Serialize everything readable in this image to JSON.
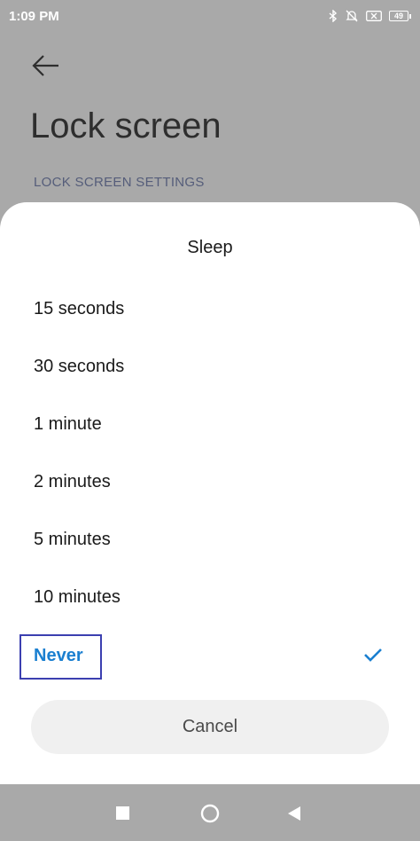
{
  "status_bar": {
    "time": "1:09 PM",
    "battery": "49",
    "icons": [
      "bluetooth-icon",
      "muted-bell-icon",
      "sim-x-icon",
      "battery-icon"
    ]
  },
  "page": {
    "title": "Lock screen",
    "section_header": "LOCK SCREEN SETTINGS",
    "back_icon": "back-arrow-icon"
  },
  "dialog": {
    "title": "Sleep",
    "options": [
      {
        "label": "15 seconds",
        "selected": false
      },
      {
        "label": "30 seconds",
        "selected": false
      },
      {
        "label": "1 minute",
        "selected": false
      },
      {
        "label": "2 minutes",
        "selected": false
      },
      {
        "label": "5 minutes",
        "selected": false
      },
      {
        "label": "10 minutes",
        "selected": false
      },
      {
        "label": "Never",
        "selected": true
      }
    ],
    "cancel_label": "Cancel",
    "accent_color": "#1a7fd0"
  },
  "nav_bar": {
    "icons": [
      "recents-square-icon",
      "home-circle-icon",
      "back-triangle-icon"
    ]
  }
}
